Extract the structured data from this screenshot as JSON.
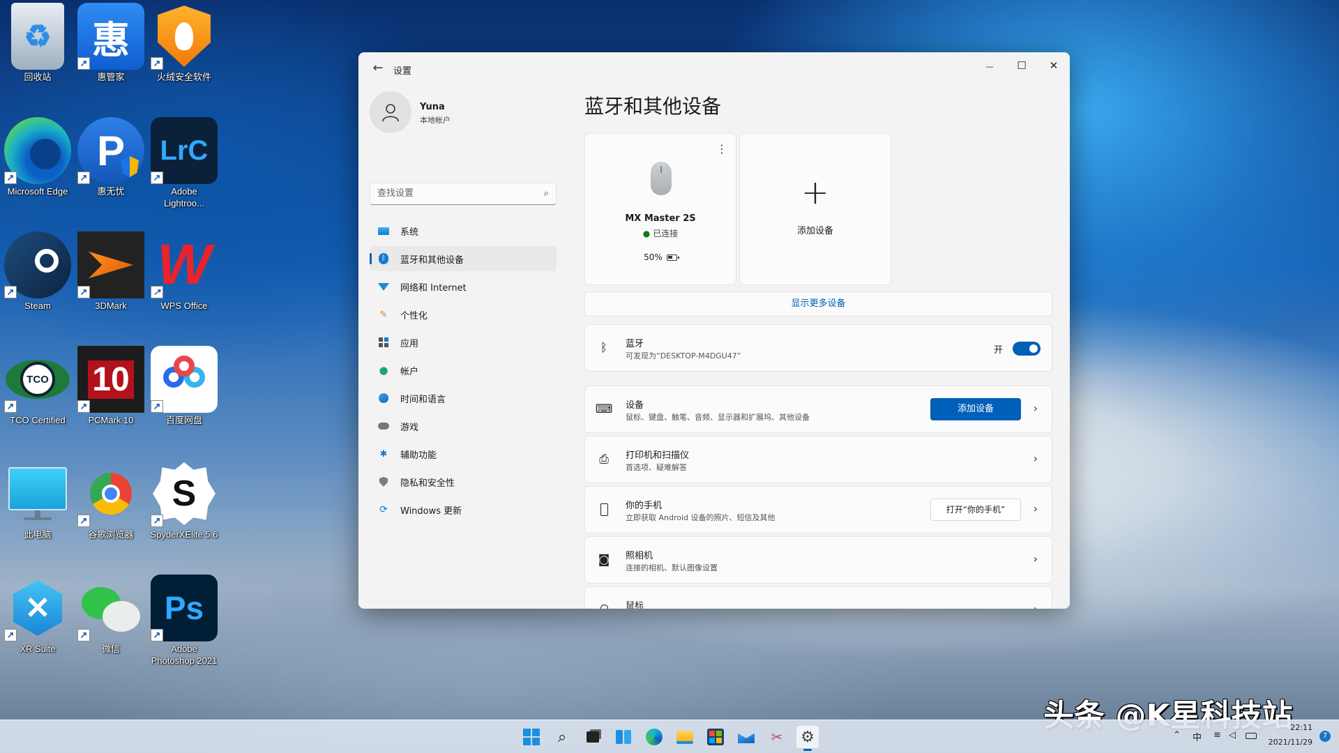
{
  "desktop": {
    "icons": [
      {
        "label": "回收站",
        "glyph": "♻"
      },
      {
        "label": "惠管家",
        "glyph": "惠"
      },
      {
        "label": "火绒安全软件",
        "glyph": ""
      },
      {
        "label": "Microsoft Edge",
        "glyph": ""
      },
      {
        "label": "惠无忧",
        "glyph": "P"
      },
      {
        "label": "Adobe\nLightroo...",
        "glyph": "LrC"
      },
      {
        "label": "Steam",
        "glyph": ""
      },
      {
        "label": "3DMark",
        "glyph": ""
      },
      {
        "label": "WPS Office",
        "glyph": "W"
      },
      {
        "label": "TCO Certified",
        "glyph": "TCO"
      },
      {
        "label": "PCMark 10",
        "glyph": "10"
      },
      {
        "label": "百度网盘",
        "glyph": ""
      },
      {
        "label": "此电脑",
        "glyph": ""
      },
      {
        "label": "谷歌浏览器",
        "glyph": ""
      },
      {
        "label": "SpyderXElite 5.6",
        "glyph": "S"
      },
      {
        "label": "XR Suite",
        "glyph": "✕"
      },
      {
        "label": "微信",
        "glyph": ""
      },
      {
        "label": "Adobe\nPhotoshop 2021",
        "glyph": "Ps"
      }
    ]
  },
  "window": {
    "title": "设置",
    "controls": {
      "minimize": "—",
      "maximize": "☐",
      "close": "✕"
    }
  },
  "user": {
    "name": "Yuna",
    "account_type": "本地帐户"
  },
  "search": {
    "placeholder": "查找设置"
  },
  "nav": [
    {
      "label": "系统",
      "icon": "system-icon",
      "active": false
    },
    {
      "label": "蓝牙和其他设备",
      "icon": "bluetooth-icon",
      "active": true
    },
    {
      "label": "网络和 Internet",
      "icon": "wifi-icon",
      "active": false
    },
    {
      "label": "个性化",
      "icon": "brush-icon",
      "active": false
    },
    {
      "label": "应用",
      "icon": "apps-icon",
      "active": false
    },
    {
      "label": "帐户",
      "icon": "person-icon",
      "active": false
    },
    {
      "label": "时间和语言",
      "icon": "globe-icon",
      "active": false
    },
    {
      "label": "游戏",
      "icon": "gamepad-icon",
      "active": false
    },
    {
      "label": "辅助功能",
      "icon": "accessibility-icon",
      "active": false
    },
    {
      "label": "隐私和安全性",
      "icon": "shield-icon",
      "active": false
    },
    {
      "label": "Windows 更新",
      "icon": "update-icon",
      "active": false
    }
  ],
  "page": {
    "title": "蓝牙和其他设备",
    "device": {
      "name": "MX Master 2S",
      "status": "已连接",
      "battery": "50%"
    },
    "add_device_card": {
      "label": "添加设备"
    },
    "show_more": "显示更多设备",
    "bluetooth": {
      "title": "蓝牙",
      "subtitle": "可发现为“DESKTOP-M4DGU47”",
      "toggle_label": "开",
      "on": true
    },
    "devices_row": {
      "title": "设备",
      "subtitle": "鼠标、键盘、触笔、音频、显示器和扩展坞、其他设备",
      "button": "添加设备"
    },
    "printers_row": {
      "title": "打印机和扫描仪",
      "subtitle": "首选项、疑难解答"
    },
    "phone_row": {
      "title": "你的手机",
      "subtitle": "立即获取 Android 设备的照片、短信及其他",
      "button": "打开“你的手机”"
    },
    "camera_row": {
      "title": "照相机",
      "subtitle": "连接的相机、默认图像设置"
    },
    "mouse_row": {
      "title": "鼠标"
    }
  },
  "watermark": "头条 @K星科技站",
  "taskbar": {
    "apps": [
      "start-icon",
      "search-icon",
      "task-view-icon",
      "widgets-icon",
      "edge-icon",
      "file-explorer-icon",
      "store-icon",
      "mail-icon",
      "snipping-tool-icon",
      "settings-icon"
    ],
    "tray": {
      "ime": "中"
    },
    "clock": {
      "time": "22:11",
      "date": "2021/11/29"
    },
    "notifications": "7"
  }
}
